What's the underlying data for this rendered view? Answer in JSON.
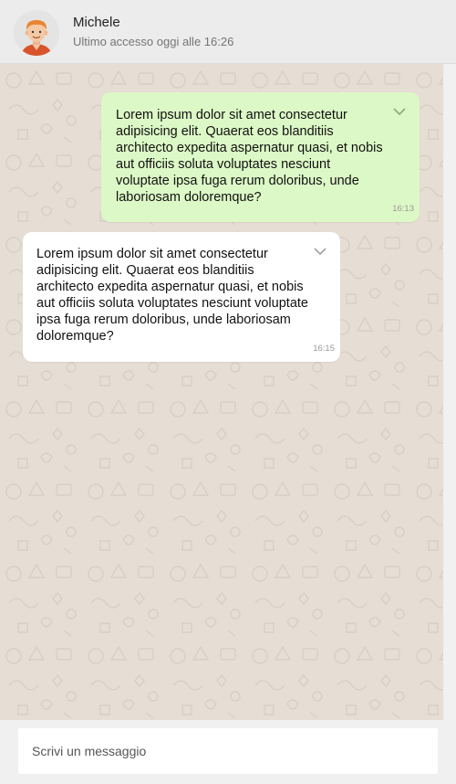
{
  "header": {
    "contact_name": "Michele",
    "last_seen": "Ultimo accesso oggi alle 16:26"
  },
  "messages": [
    {
      "direction": "sent",
      "text": "Lorem ipsum dolor sit amet consectetur adipisicing elit. Quaerat eos blanditiis architecto expedita aspernatur quasi, et nobis aut officiis soluta voluptates nesciunt voluptate ipsa fuga rerum doloribus, unde laboriosam doloremque?",
      "time": "16:13"
    },
    {
      "direction": "received",
      "text": "Lorem ipsum dolor sit amet consectetur adipisicing elit. Quaerat eos blanditiis architecto expedita aspernatur quasi, et nobis aut officiis soluta voluptates nesciunt voluptate ipsa fuga rerum doloribus, unde laboriosam doloremque?",
      "time": "16:15"
    }
  ],
  "composer": {
    "placeholder": "Scrivi un messaggio"
  },
  "colors": {
    "sent_bubble": "#dcf8c6",
    "received_bubble": "#ffffff",
    "chat_background": "#e6ded4",
    "header_background": "#ececec"
  },
  "icons": {
    "avatar": "user-avatar-icon",
    "menu": "chevron-down-icon"
  }
}
